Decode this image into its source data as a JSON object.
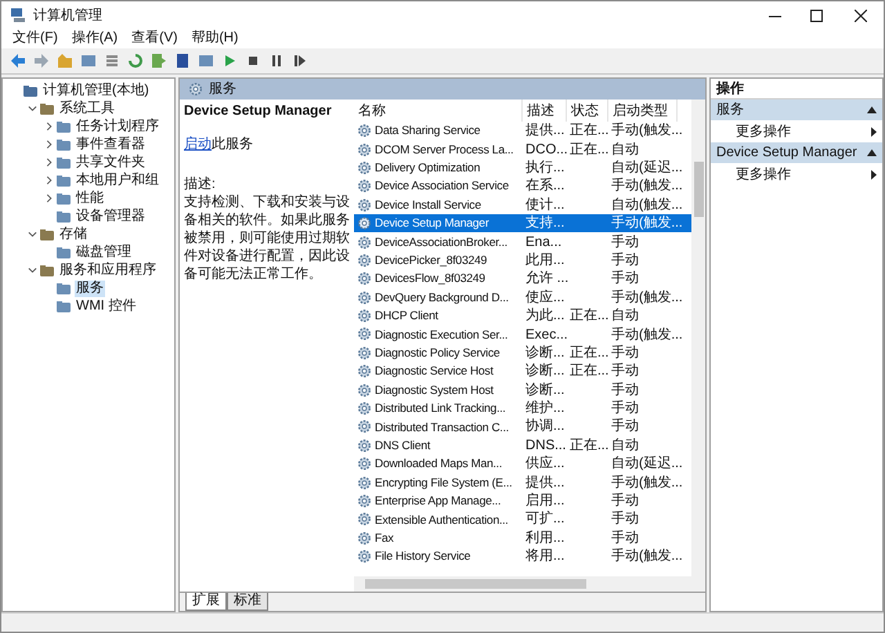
{
  "window": {
    "title": "计算机管理"
  },
  "menu": [
    "文件(F)",
    "操作(A)",
    "查看(V)",
    "帮助(H)"
  ],
  "tree": [
    {
      "label": "计算机管理(本地)",
      "selected": false,
      "children": [
        {
          "label": "系统工具",
          "selected": false,
          "expanded": true,
          "children": [
            {
              "label": "任务计划程序",
              "selected": false,
              "expanded": false
            },
            {
              "label": "事件查看器",
              "selected": false,
              "expanded": false
            },
            {
              "label": "共享文件夹",
              "selected": false,
              "expanded": false
            },
            {
              "label": "本地用户和组",
              "selected": false,
              "expanded": false
            },
            {
              "label": "性能",
              "selected": false,
              "expanded": false
            },
            {
              "label": "设备管理器",
              "selected": false
            }
          ]
        },
        {
          "label": "存储",
          "selected": false,
          "expanded": true,
          "children": [
            {
              "label": "磁盘管理",
              "selected": false
            }
          ]
        },
        {
          "label": "服务和应用程序",
          "selected": false,
          "expanded": true,
          "children": [
            {
              "label": "服务",
              "selected": true
            },
            {
              "label": "WMI 控件",
              "selected": false
            }
          ]
        }
      ]
    }
  ],
  "panel": {
    "title": "服务"
  },
  "detail": {
    "service_title": "Device Setup Manager",
    "start_link": "启动",
    "start_suffix": "此服务",
    "description_label": "描述:",
    "description": "支持检测、下载和安装与设备相关的软件。如果此服务被禁用，则可能使用过期软件对设备进行配置，因此设备可能无法正常工作。"
  },
  "table": {
    "columns": [
      "名称",
      "描述",
      "状态",
      "启动类型"
    ],
    "rows": [
      {
        "name": "Data Sharing Service",
        "description": "提供...",
        "status": "正在...",
        "startup_type": "手动(触发...",
        "selected": false
      },
      {
        "name": "DCOM Server Process La...",
        "description": "DCO...",
        "status": "正在...",
        "startup_type": "自动",
        "selected": false
      },
      {
        "name": "Delivery Optimization",
        "description": "执行...",
        "status": "",
        "startup_type": "自动(延迟...",
        "selected": false
      },
      {
        "name": "Device Association Service",
        "description": "在系...",
        "status": "",
        "startup_type": "手动(触发...",
        "selected": false
      },
      {
        "name": "Device Install Service",
        "description": "使计...",
        "status": "",
        "startup_type": "自动(触发...",
        "selected": false
      },
      {
        "name": "Device Setup Manager",
        "description": "支持...",
        "status": "",
        "startup_type": "手动(触发...",
        "selected": true
      },
      {
        "name": "DeviceAssociationBroker...",
        "description": "Ena...",
        "status": "",
        "startup_type": "手动",
        "selected": false
      },
      {
        "name": "DevicePicker_8f03249",
        "description": "此用...",
        "status": "",
        "startup_type": "手动",
        "selected": false
      },
      {
        "name": "DevicesFlow_8f03249",
        "description": "允许 ...",
        "status": "",
        "startup_type": "手动",
        "selected": false
      },
      {
        "name": "DevQuery Background D...",
        "description": "使应...",
        "status": "",
        "startup_type": "手动(触发...",
        "selected": false
      },
      {
        "name": "DHCP Client",
        "description": "为此...",
        "status": "正在...",
        "startup_type": "自动",
        "selected": false
      },
      {
        "name": "Diagnostic Execution Ser...",
        "description": "Exec...",
        "status": "",
        "startup_type": "手动(触发...",
        "selected": false
      },
      {
        "name": "Diagnostic Policy Service",
        "description": "诊断...",
        "status": "正在...",
        "startup_type": "手动",
        "selected": false
      },
      {
        "name": "Diagnostic Service Host",
        "description": "诊断...",
        "status": "正在...",
        "startup_type": "手动",
        "selected": false
      },
      {
        "name": "Diagnostic System Host",
        "description": "诊断...",
        "status": "",
        "startup_type": "手动",
        "selected": false
      },
      {
        "name": "Distributed Link Tracking...",
        "description": "维护...",
        "status": "",
        "startup_type": "手动",
        "selected": false
      },
      {
        "name": "Distributed Transaction C...",
        "description": "协调...",
        "status": "",
        "startup_type": "手动",
        "selected": false
      },
      {
        "name": "DNS Client",
        "description": "DNS...",
        "status": "正在...",
        "startup_type": "自动",
        "selected": false
      },
      {
        "name": "Downloaded Maps Man...",
        "description": "供应...",
        "status": "",
        "startup_type": "自动(延迟...",
        "selected": false
      },
      {
        "name": "Encrypting File System (E...",
        "description": "提供...",
        "status": "",
        "startup_type": "手动(触发...",
        "selected": false
      },
      {
        "name": "Enterprise App Manage...",
        "description": "启用...",
        "status": "",
        "startup_type": "手动",
        "selected": false
      },
      {
        "name": "Extensible Authentication...",
        "description": "可扩...",
        "status": "",
        "startup_type": "手动",
        "selected": false
      },
      {
        "name": "Fax",
        "description": "利用...",
        "status": "",
        "startup_type": "手动",
        "selected": false
      },
      {
        "name": "File History Service",
        "description": "将用...",
        "status": "",
        "startup_type": "手动(触发...",
        "selected": false
      }
    ]
  },
  "bottom_tabs": [
    {
      "label": "扩展",
      "selected": true
    },
    {
      "label": "标准",
      "selected": false
    }
  ],
  "actions": {
    "title": "操作",
    "sections": [
      {
        "title": "服务",
        "expanded": true,
        "items": [
          "更多操作"
        ]
      },
      {
        "title": "Device Setup Manager",
        "expanded": true,
        "items": [
          "更多操作"
        ]
      }
    ]
  }
}
